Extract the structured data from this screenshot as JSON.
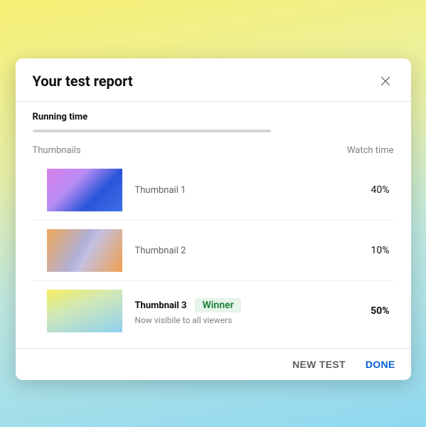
{
  "dialog": {
    "title": "Your test report"
  },
  "running": {
    "label": "Running time"
  },
  "columns": {
    "left": "Thumbnails",
    "right": "Watch time"
  },
  "rows": [
    {
      "label": "Thumbnail 1",
      "value": "40%",
      "winner": false
    },
    {
      "label": "Thumbnail 2",
      "value": "10%",
      "winner": false
    },
    {
      "label": "Thumbnail 3",
      "value": "50%",
      "winner": true,
      "badge": "Winner",
      "subtext": "Now visibile to all viewers"
    }
  ],
  "footer": {
    "newTest": "NEW TEST",
    "done": "DONE"
  }
}
